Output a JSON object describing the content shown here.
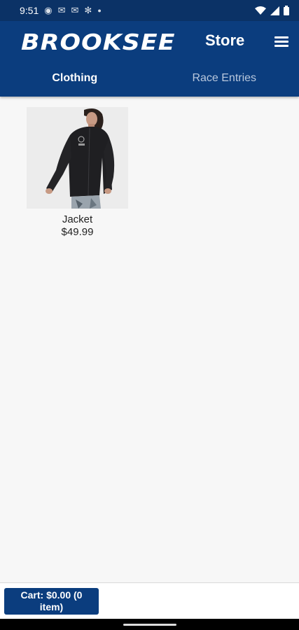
{
  "status_bar": {
    "time": "9:51",
    "left_icons": [
      "g-icon",
      "mail-icon",
      "mail-icon",
      "gear-icon",
      "dot-icon"
    ],
    "right_icons": [
      "wifi-icon",
      "signal-icon",
      "battery-icon"
    ]
  },
  "header": {
    "logo_text": "BROOKSEE",
    "title": "Store",
    "tabs": [
      {
        "label": "Clothing",
        "active": true
      },
      {
        "label": "Race Entries",
        "active": false
      }
    ]
  },
  "products": [
    {
      "name": "Jacket",
      "price": "$49.99",
      "image_icon": "jacket-photo"
    }
  ],
  "cart": {
    "label": "Cart: $0.00 (0 item)"
  },
  "colors": {
    "primary": "#0b3d7e",
    "status_bar": "#0b3266",
    "background": "#f7f7f7"
  }
}
